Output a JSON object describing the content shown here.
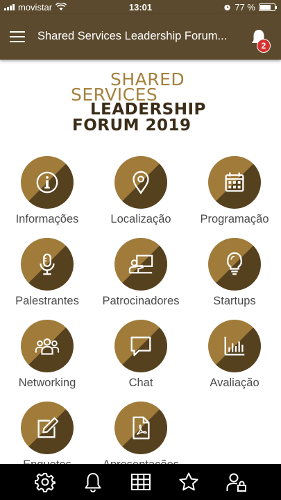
{
  "status_bar": {
    "carrier": "movistar",
    "time": "13:01",
    "battery": "77 %"
  },
  "header": {
    "title": "Shared Services Leadership Forum...",
    "notification_count": "2"
  },
  "logo": {
    "line1": "SHARED",
    "line2": "SERVICES",
    "line3": "LEADERSHIP",
    "line4": "FORUM 2019"
  },
  "menu": {
    "items": [
      {
        "label": "Informações",
        "icon": "info-icon"
      },
      {
        "label": "Localização",
        "icon": "location-pin-icon"
      },
      {
        "label": "Programação",
        "icon": "calendar-icon"
      },
      {
        "label": "Palestrantes",
        "icon": "microphone-icon"
      },
      {
        "label": "Patrocinadores",
        "icon": "presenter-icon"
      },
      {
        "label": "Startups",
        "icon": "lightbulb-icon"
      },
      {
        "label": "Networking",
        "icon": "people-icon"
      },
      {
        "label": "Chat",
        "icon": "chat-bubble-icon"
      },
      {
        "label": "Avaliação",
        "icon": "bar-chart-icon"
      },
      {
        "label": "Enquetes",
        "icon": "edit-icon"
      },
      {
        "label": "Apresentações",
        "icon": "pdf-file-icon"
      }
    ]
  },
  "tab_bar": {
    "icons": [
      "gear-icon",
      "bell-icon",
      "grid-icon",
      "star-icon",
      "user-lock-icon"
    ]
  },
  "colors": {
    "header_bg": "#5b4a2e",
    "gold": "#a07b3a",
    "dark_brown": "#56411f",
    "badge_red": "#d6312f",
    "tab_bar_bg": "#000000"
  }
}
